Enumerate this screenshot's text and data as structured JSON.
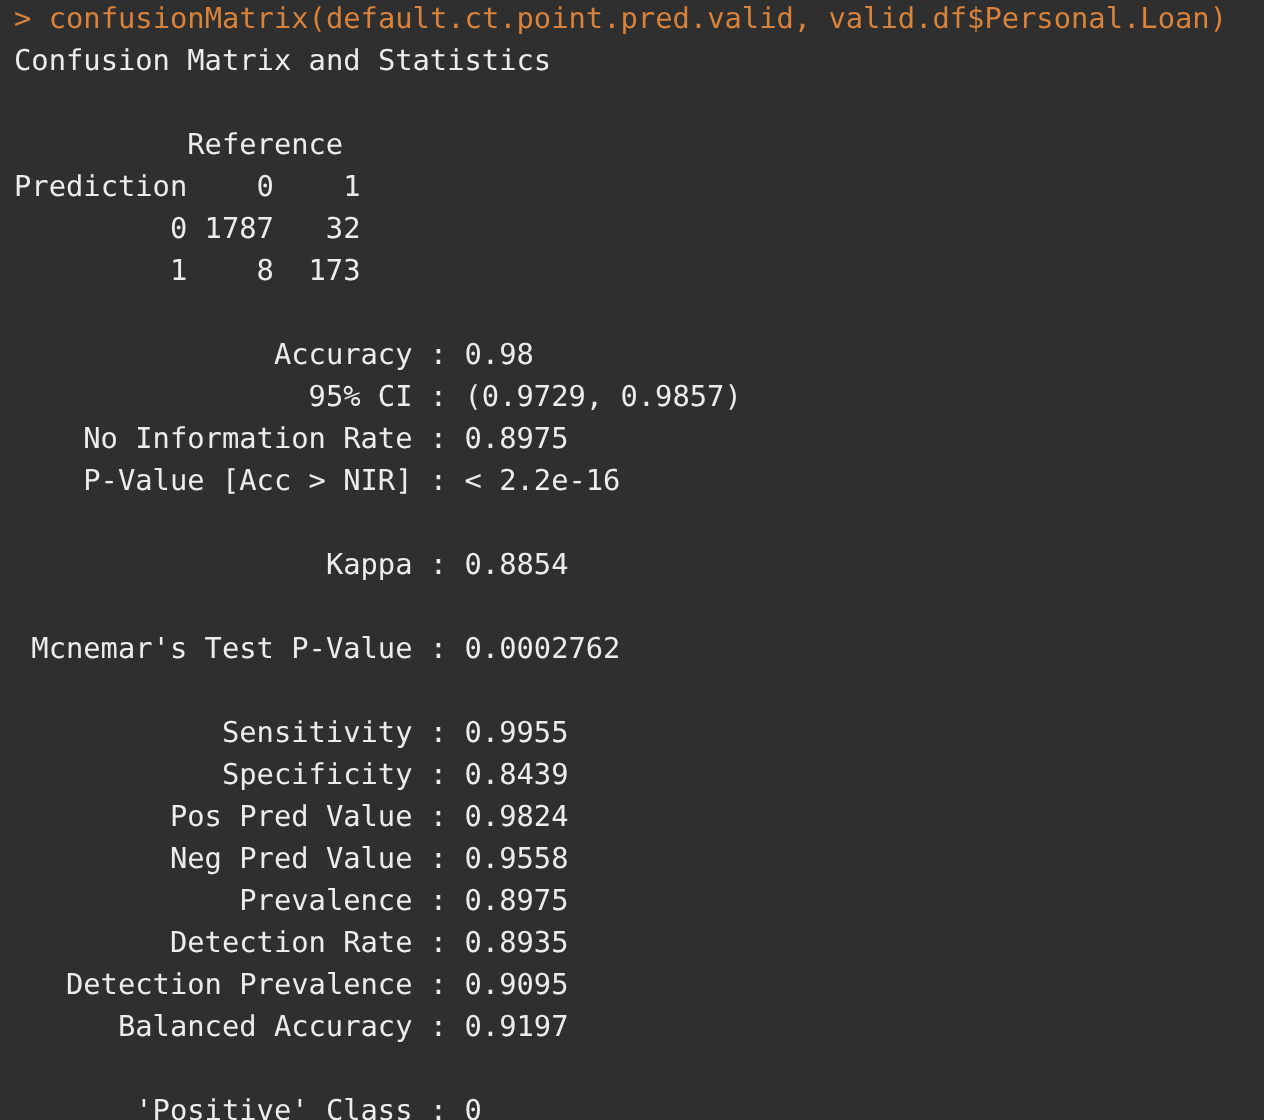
{
  "console": {
    "prompt": ">",
    "command": "confusionMatrix(default.ct.point.pred.valid, valid.df$Personal.Loan)",
    "title": "Confusion Matrix and Statistics",
    "matrix": {
      "reference_label": "Reference",
      "prediction_label": "Prediction",
      "columns": [
        "0",
        "1"
      ],
      "rows": [
        {
          "label": "0",
          "values": [
            "1787",
            "32"
          ]
        },
        {
          "label": "1",
          "values": [
            "8",
            "173"
          ]
        }
      ]
    },
    "stat_groups": [
      [
        {
          "label": "Accuracy :",
          "value": "0.98"
        },
        {
          "label": "95% CI :",
          "value": "(0.9729, 0.9857)"
        },
        {
          "label": "No Information Rate :",
          "value": "0.8975"
        },
        {
          "label": "P-Value [Acc > NIR] :",
          "value": "< 2.2e-16"
        }
      ],
      [
        {
          "label": "Kappa :",
          "value": "0.8854"
        }
      ],
      [
        {
          "label": "Mcnemar's Test P-Value :",
          "value": "0.0002762"
        }
      ],
      [
        {
          "label": "Sensitivity :",
          "value": "0.9955"
        },
        {
          "label": "Specificity :",
          "value": "0.8439"
        },
        {
          "label": "Pos Pred Value :",
          "value": "0.9824"
        },
        {
          "label": "Neg Pred Value :",
          "value": "0.9558"
        },
        {
          "label": "Prevalence :",
          "value": "0.8975"
        },
        {
          "label": "Detection Rate :",
          "value": "0.8935"
        },
        {
          "label": "Detection Prevalence :",
          "value": "0.9095"
        },
        {
          "label": "Balanced Accuracy :",
          "value": "0.9197"
        }
      ],
      [
        {
          "label": "'Positive' Class :",
          "value": "0"
        }
      ]
    ]
  }
}
